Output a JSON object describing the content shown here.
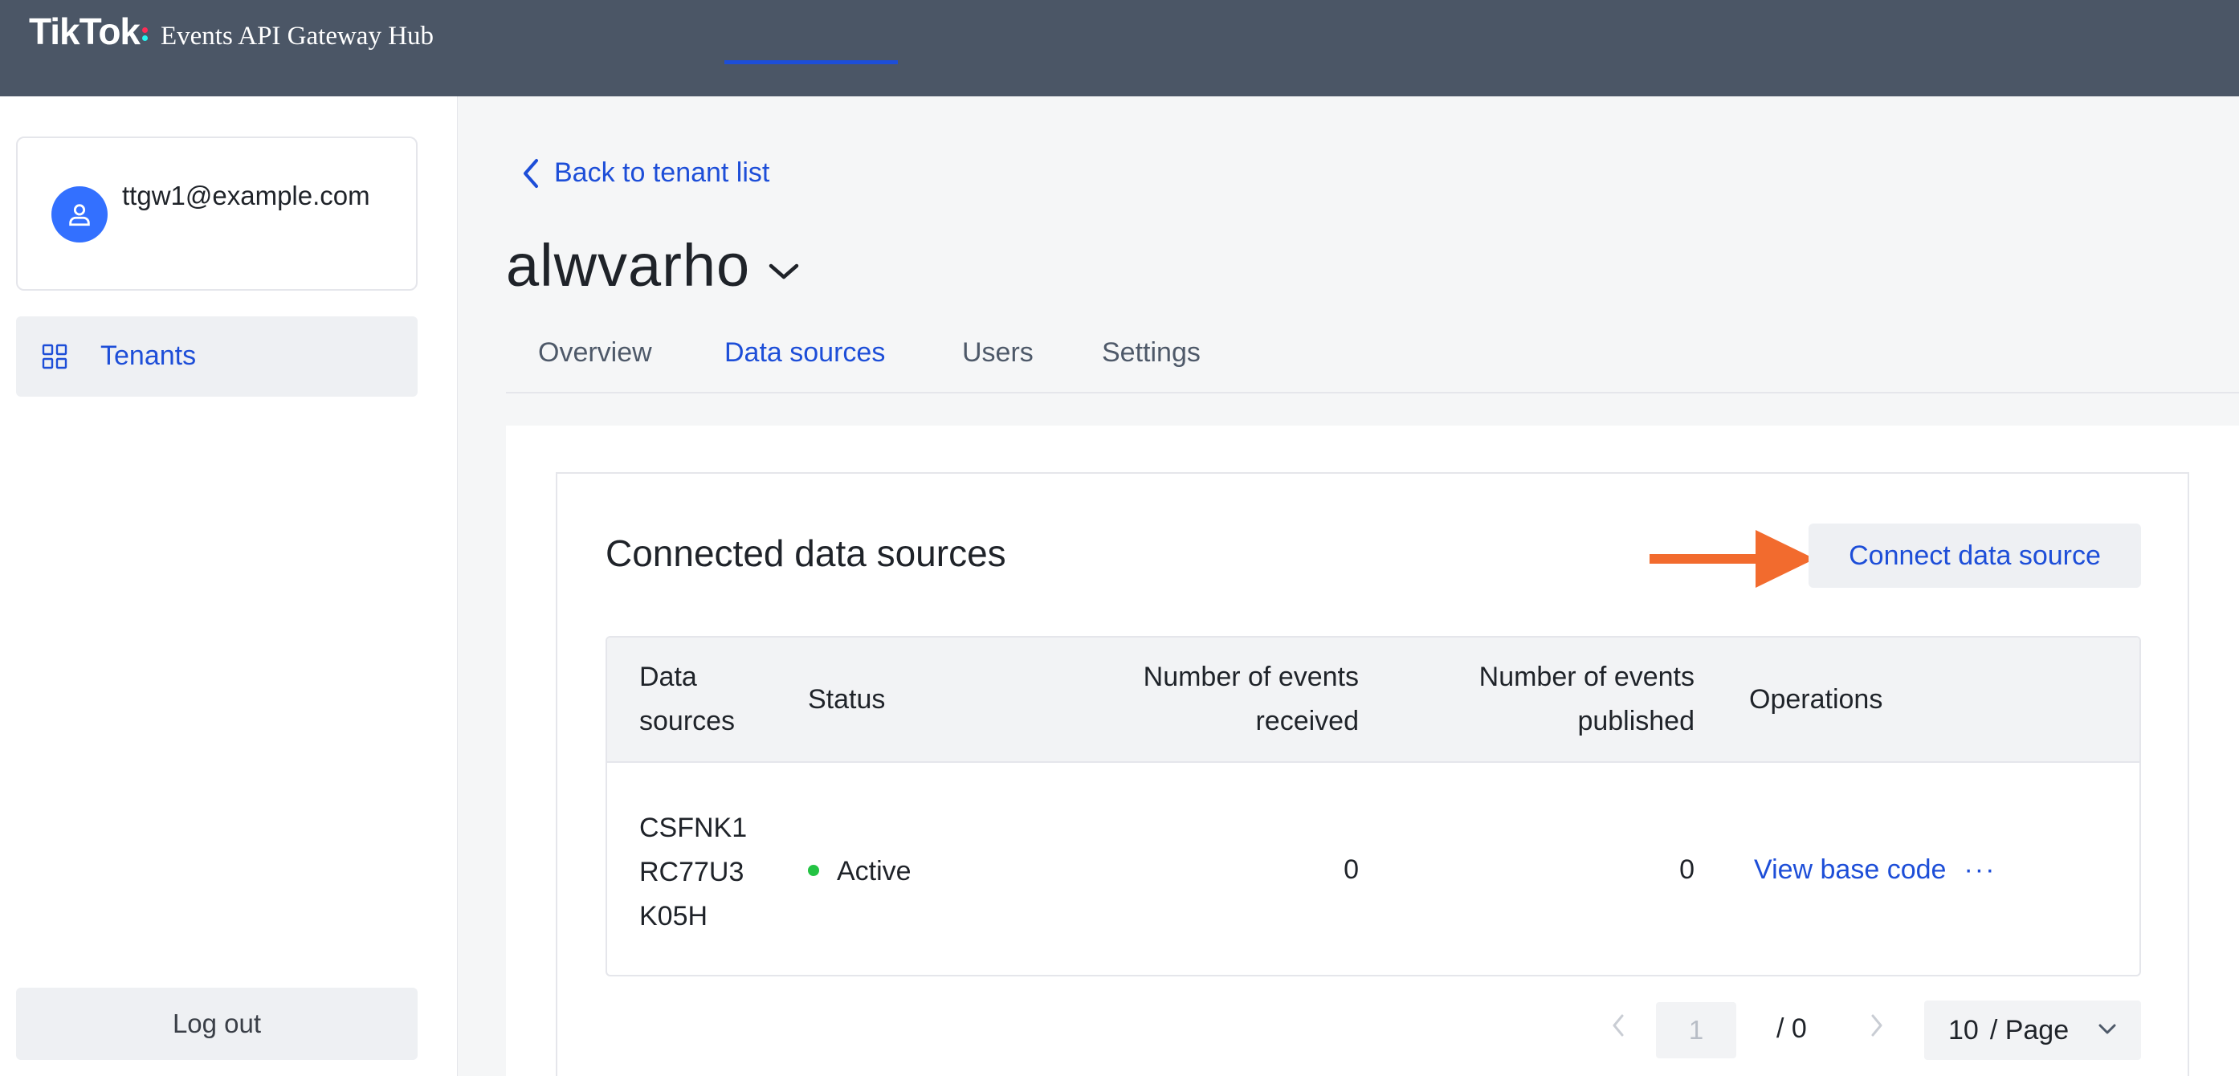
{
  "header": {
    "logo": "TikTok",
    "product": "Events API Gateway Hub"
  },
  "sidebar": {
    "user_email": "ttgw1@example.com",
    "items": [
      {
        "label": "Tenants",
        "icon": "grid-icon",
        "active": true
      }
    ],
    "logout_label": "Log out"
  },
  "main": {
    "back_label": "Back to tenant list",
    "tenant_name": "alwvarho",
    "tabs": [
      {
        "label": "Overview",
        "active": false
      },
      {
        "label": "Data sources",
        "active": true
      },
      {
        "label": "Users",
        "active": false
      },
      {
        "label": "Settings",
        "active": false
      }
    ],
    "section_title": "Connected data sources",
    "connect_label": "Connect data source",
    "table": {
      "columns": [
        "Data sources",
        "Status",
        "Number of events received",
        "Number of events published",
        "Operations"
      ],
      "rows": [
        {
          "data_source": "CSFNK1RC77U3K05H",
          "status": "Active",
          "received": "0",
          "published": "0",
          "operation": "View base code",
          "more": "···"
        }
      ]
    },
    "pagination": {
      "current_page": "1",
      "total_label": "/ 0",
      "page_size_value": "10",
      "page_size_unit": "/ Page"
    }
  },
  "colors": {
    "topbar": "#4b5666",
    "accent": "#1d4ed8",
    "active_status": "#23c343",
    "annotation_arrow": "#f26b2e"
  }
}
